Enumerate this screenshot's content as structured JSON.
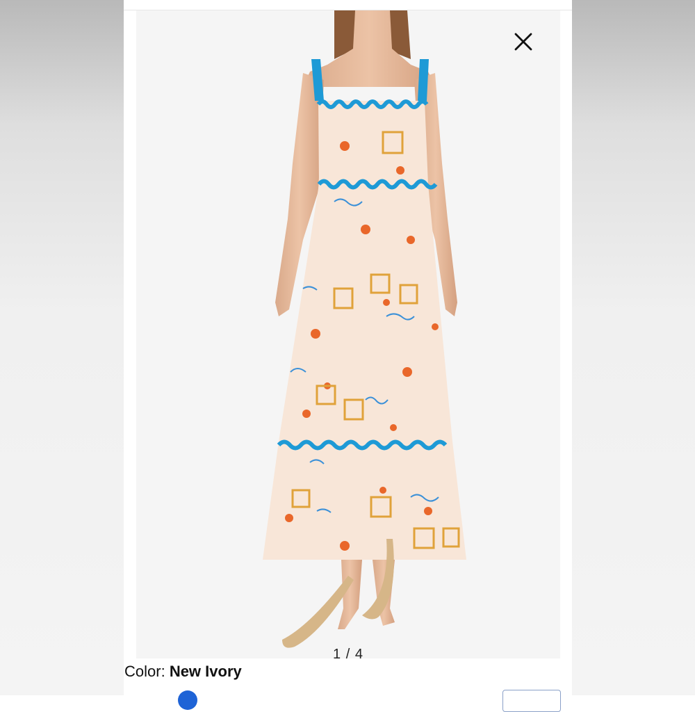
{
  "viewer": {
    "image_counter": "1 / 4",
    "close_icon": "close-icon"
  },
  "product": {
    "color_label": "Color:",
    "color_value": "New Ivory",
    "image_alt": "Model wearing ivory maxi dress with blue ric-rac trim and seaside print"
  },
  "colors": {
    "dress_base": "#f8e6d8",
    "trim_blue": "#1e9ad6",
    "print_orange": "#e9672a",
    "print_gold": "#e0a23a",
    "swatch_selected": "#1e63d6"
  }
}
